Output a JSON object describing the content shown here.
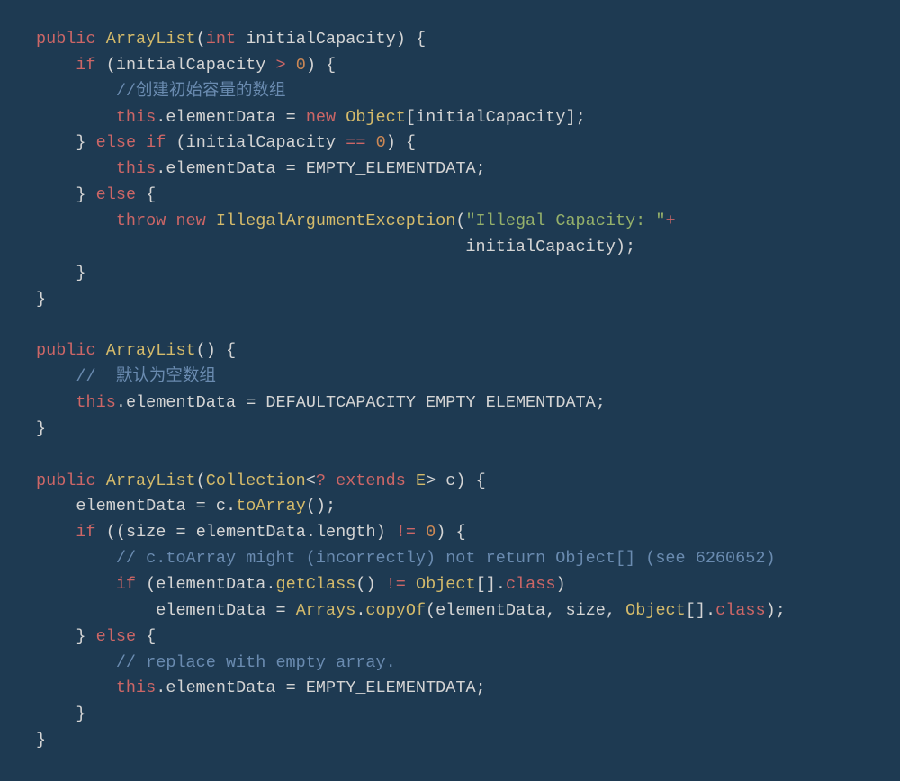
{
  "code": {
    "tokens": {
      "public1": "public",
      "arraylist1": "ArrayList",
      "lparen1": "(",
      "int1": "int",
      "initcap1": "initialCapacity",
      "rparen1": ")",
      "lbrace1": "{",
      "if1": "if",
      "lparen2": "(",
      "initcap2": "initialCapacity",
      "gt": ">",
      "zero1": "0",
      "rparen2": ")",
      "lbrace2": "{",
      "comment1": "//创建初始容量的数组",
      "this1": "this",
      "dot1": ".",
      "elemdata1": "elementData",
      "eq1": "=",
      "new1": "new",
      "object1": "Object",
      "lbracket1": "[",
      "initcap3": "initialCapacity",
      "rbracket1": "]",
      "semi1": ";",
      "rbrace1": "}",
      "else1": "else",
      "if2": "if",
      "lparen3": "(",
      "initcap4": "initialCapacity",
      "eqeq": "==",
      "zero2": "0",
      "rparen3": ")",
      "lbrace3": "{",
      "this2": "this",
      "dot2": ".",
      "elemdata2": "elementData",
      "eq2": "=",
      "empty1": "EMPTY_ELEMENTDATA",
      "semi2": ";",
      "rbrace2": "}",
      "else2": "else",
      "lbrace4": "{",
      "throw1": "throw",
      "new2": "new",
      "illegal": "IllegalArgumentException",
      "lparen4": "(",
      "string1": "\"Illegal Capacity: \"",
      "plus1": "+",
      "initcap5": "initialCapacity",
      "rparen5": ")",
      "semi3": ";",
      "rbrace3": "}",
      "rbrace4": "}",
      "public2": "public",
      "arraylist2": "ArrayList",
      "lparen6": "(",
      "rparen6": ")",
      "lbrace5": "{",
      "comment2": "//  默认为空数组",
      "this3": "this",
      "dot3": ".",
      "elemdata3": "elementData",
      "eq3": "=",
      "defcap": "DEFAULTCAPACITY_EMPTY_ELEMENTDATA",
      "semi4": ";",
      "rbrace5": "}",
      "public3": "public",
      "arraylist3": "ArrayList",
      "lparen7": "(",
      "collection": "Collection",
      "lt1": "<",
      "wildc": "?",
      "extends1": "extends",
      "e1": "E",
      "gt2": ">",
      "c1": "c",
      "rparen7": ")",
      "lbrace6": "{",
      "elemdata4": "elementData",
      "eq4": "=",
      "c2": "c",
      "dot4": ".",
      "toarray": "toArray",
      "lparen8": "(",
      "rparen8": ")",
      "semi5": ";",
      "if3": "if",
      "lparen9": "(",
      "lparen10": "(",
      "size1": "size",
      "eq5": "=",
      "elemdata5": "elementData",
      "dot5": ".",
      "length1": "length",
      "rparen10": ")",
      "noteq": "!=",
      "zero3": "0",
      "rparen11": ")",
      "lbrace7": "{",
      "comment3": "// c.toArray might (incorrectly) not return Object[] (see 6260652)",
      "if4": "if",
      "lparen12": "(",
      "elemdata6": "elementData",
      "dot6": ".",
      "getclass": "getClass",
      "lparen13": "(",
      "rparen13": ")",
      "noteq2": "!=",
      "object2": "Object",
      "lbracket2": "[",
      "rbracket2": "]",
      "dot7": ".",
      "class1": "class",
      "rparen14": ")",
      "elemdata7": "elementData",
      "eq6": "=",
      "arrays": "Arrays",
      "dot8": ".",
      "copyof": "copyOf",
      "lparen15": "(",
      "elemdata8": "elementData",
      "comma1": ",",
      "size2": "size",
      "comma2": ",",
      "object3": "Object",
      "lbracket3": "[",
      "rbracket3": "]",
      "dot9": ".",
      "class2": "class",
      "rparen15": ")",
      "semi6": ";",
      "rbrace6": "}",
      "else3": "else",
      "lbrace8": "{",
      "comment4": "// replace with empty array.",
      "this4": "this",
      "dot10": ".",
      "elemdata9": "elementData",
      "eq7": "=",
      "empty2": "EMPTY_ELEMENTDATA",
      "semi7": ";",
      "rbrace7": "}",
      "rbrace8": "}"
    }
  }
}
